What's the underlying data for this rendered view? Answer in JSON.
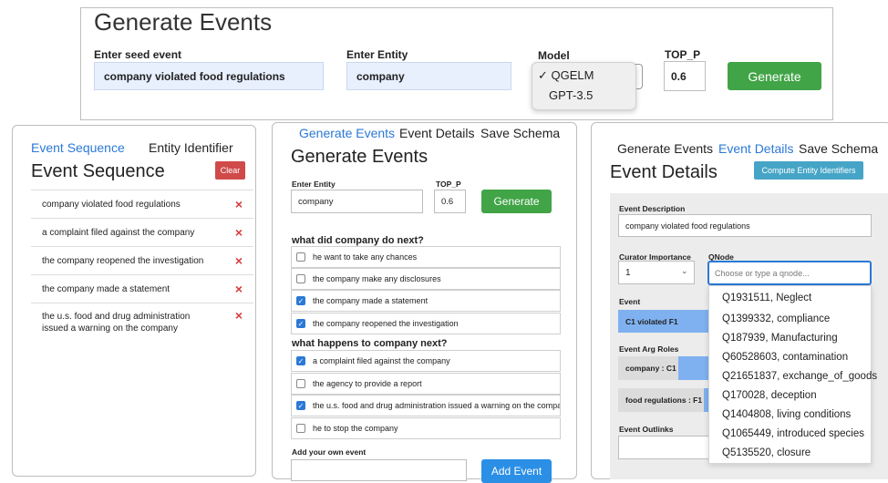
{
  "top": {
    "title": "Generate Events",
    "seed_label": "Enter seed event",
    "seed_value": "company violated food regulations",
    "entity_label": "Enter Entity",
    "entity_value": "company",
    "model_label": "Model",
    "model_options": [
      {
        "label": "QGELM",
        "checked": true,
        "check": "✓"
      },
      {
        "label": "GPT-3.5",
        "checked": false,
        "check": ""
      }
    ],
    "top_p_label": "TOP_P",
    "top_p_value": "0.6",
    "generate_label": "Generate"
  },
  "left": {
    "tabs": [
      "Event Sequence",
      "Entity Identifier"
    ],
    "title": "Event Sequence",
    "clear_label": "Clear",
    "remove_icon": "×",
    "events": [
      "company violated food regulations",
      "a complaint filed against the company",
      "the company reopened the investigation",
      "the company made a statement",
      "the u.s. food and drug administration issued a warning on the company"
    ]
  },
  "middle": {
    "tabs": [
      "Generate Events",
      "Event Details",
      "Save Schema"
    ],
    "title": "Generate Events",
    "entity_label": "Enter Entity",
    "entity_value": "company",
    "top_p_label": "TOP_P",
    "top_p_value": "0.6",
    "generate_label": "Generate",
    "next_heading": "what did company do next?",
    "next_items": [
      {
        "text": "he want to take any chances",
        "checked": false,
        "check": ""
      },
      {
        "text": "the company make any disclosures",
        "checked": false,
        "check": ""
      },
      {
        "text": "the company made a statement",
        "checked": true,
        "check": "✓"
      },
      {
        "text": "the company reopened the investigation",
        "checked": true,
        "check": "✓"
      }
    ],
    "happens_heading": "what happens to company next?",
    "happens_items": [
      {
        "text": "a complaint filed against the company",
        "checked": true,
        "check": "✓"
      },
      {
        "text": "the agency to provide a report",
        "checked": false,
        "check": ""
      },
      {
        "text": "the u.s. food and drug administration issued a warning on the company",
        "checked": true,
        "check": "✓"
      },
      {
        "text": "he to stop the company",
        "checked": false,
        "check": ""
      }
    ],
    "add_label": "Add your own event",
    "add_button": "Add Event"
  },
  "right": {
    "tabs": [
      "Generate Events",
      "Event Details",
      "Save Schema"
    ],
    "title": "Event Details",
    "compute_button": "Compute Entity Identifiers",
    "desc_label": "Event Description",
    "desc_value": "company violated food regulations",
    "curator_label": "Curator Importance",
    "curator_value": "1",
    "qnode_label": "QNode",
    "qnode_placeholder": "Choose or type a qnode...",
    "event_label": "Event",
    "event_value": "C1 violated F1",
    "arg_roles_label": "Event Arg Roles",
    "arg_roles": [
      "company : C1",
      "food regulations : F1"
    ],
    "outlinks_label": "Event Outlinks",
    "qnode_options": [
      "Q1931511, Neglect",
      "Q1399332, compliance",
      "Q187939, Manufacturing",
      "Q60528603, contamination",
      "Q21651837, exchange_of_goods",
      "Q170028, deception",
      "Q1404808, living conditions",
      "Q1065449, introduced species",
      "Q5135520, closure"
    ]
  },
  "colors": {
    "accent_blue": "#2b79d6",
    "green": "#41a447",
    "red": "#d63b3b",
    "field_bg": "#e8f0fe",
    "form_bg": "#ececec"
  },
  "icons": {
    "remove": "x-icon",
    "checkbox": "checkbox-icon",
    "dropdown": "chevron-down-icon"
  }
}
